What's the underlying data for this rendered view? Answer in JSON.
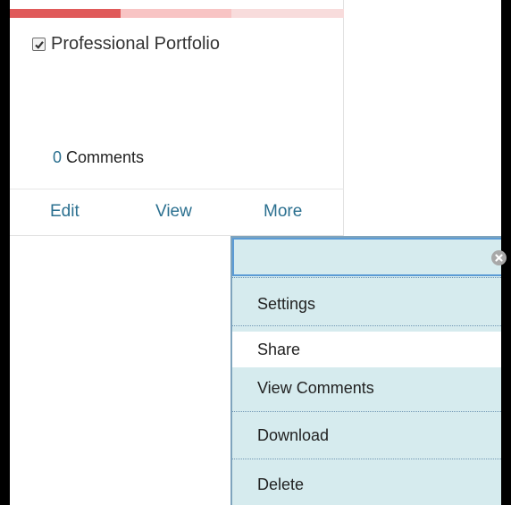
{
  "card": {
    "title": "Professional Portfolio",
    "checked": true,
    "comments": {
      "count": "0",
      "label": "Comments"
    },
    "actions": {
      "edit": "Edit",
      "view": "View",
      "more": "More"
    }
  },
  "menu": {
    "items": {
      "settings": "Settings",
      "share": "Share",
      "view_comments": "View Comments",
      "download": "Download",
      "delete": "Delete"
    },
    "highlighted": "Share"
  },
  "icons": {
    "checkbox": "checkmark-icon",
    "close": "close-icon"
  },
  "colors": {
    "progress": [
      "#e05a5a",
      "#f8c4c4",
      "#f8dcdc"
    ],
    "link": "#2a6f8f",
    "menu_bg": "#d6ebee",
    "menu_border": "#5b9bd5",
    "frame": "#000000"
  }
}
